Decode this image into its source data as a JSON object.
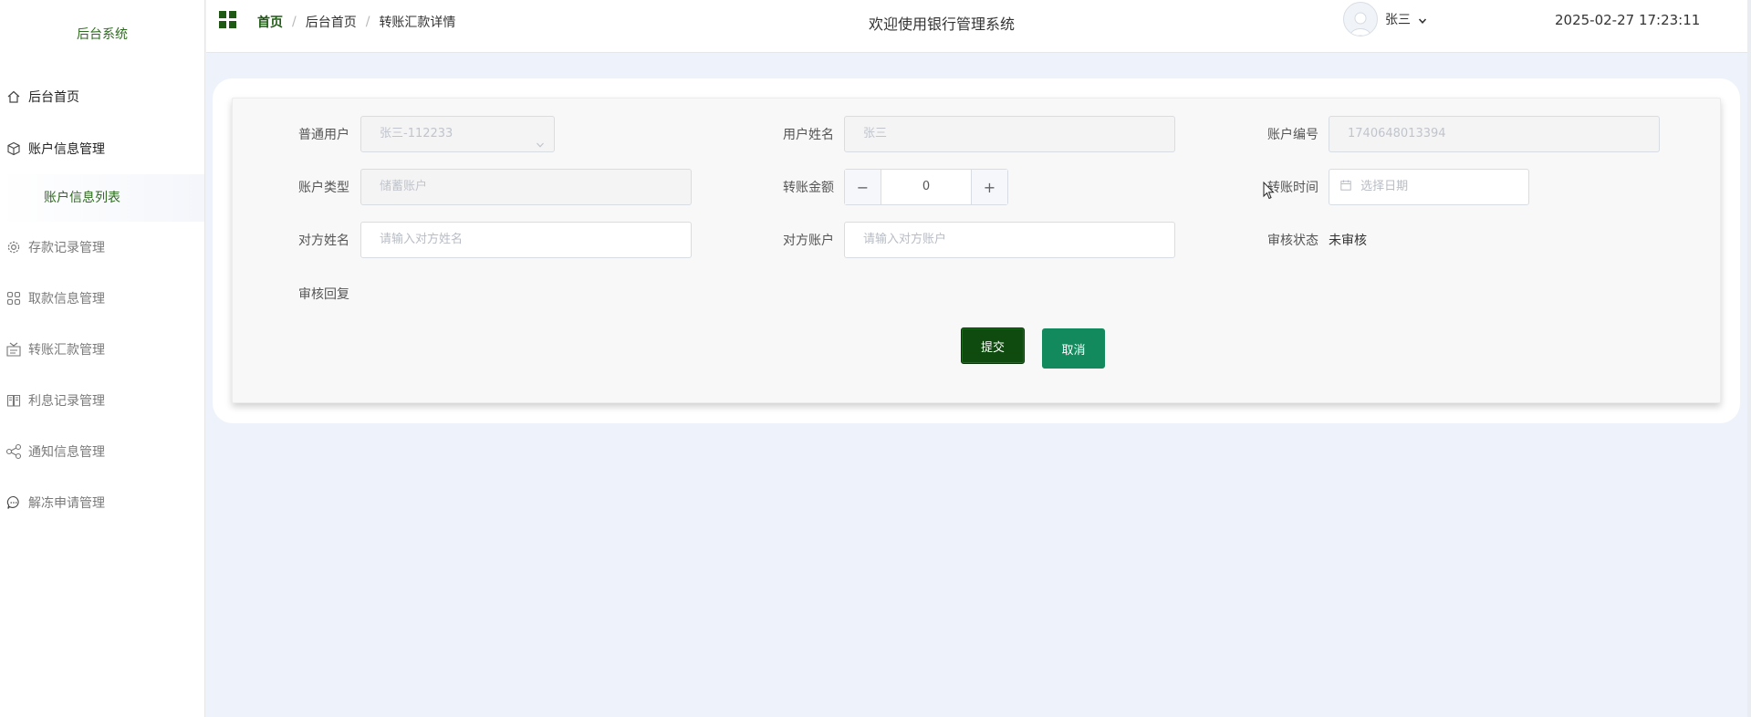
{
  "sidebar": {
    "brand": "后台系统",
    "items": [
      {
        "label": "后台首页",
        "icon": "home-icon"
      },
      {
        "label": "账户信息管理",
        "icon": "cube-icon"
      },
      {
        "label": "账户信息列表",
        "icon": ""
      },
      {
        "label": "存款记录管理",
        "icon": "gear-icon"
      },
      {
        "label": "取款信息管理",
        "icon": "grid-icon"
      },
      {
        "label": "转账汇款管理",
        "icon": "transfer-icon"
      },
      {
        "label": "利息记录管理",
        "icon": "ledger-icon"
      },
      {
        "label": "通知信息管理",
        "icon": "share-icon"
      },
      {
        "label": "解冻申请管理",
        "icon": "chat-icon"
      }
    ]
  },
  "header": {
    "breadcrumb": [
      "首页",
      "后台首页",
      "转账汇款详情"
    ],
    "breadcrumb_separator": "/",
    "title": "欢迎使用银行管理系统",
    "user_name": "张三",
    "datetime": "2025-02-27 17:23:11"
  },
  "form": {
    "user_label": "普通用户",
    "user_value": "张三-112233",
    "name_label": "用户姓名",
    "name_value": "张三",
    "account_no_label": "账户编号",
    "account_no_value": "1740648013394",
    "account_type_label": "账户类型",
    "account_type_value": "储蓄账户",
    "amount_label": "转账金额",
    "amount_value": "0",
    "amount_minus": "−",
    "amount_plus": "+",
    "time_label": "转账时间",
    "time_placeholder": "选择日期",
    "peer_name_label": "对方姓名",
    "peer_name_placeholder": "请输入对方姓名",
    "peer_account_label": "对方账户",
    "peer_account_placeholder": "请输入对方账户",
    "audit_status_label": "审核状态",
    "audit_status_value": "未审核",
    "audit_reply_label": "审核回复",
    "submit_label": "提交",
    "cancel_label": "取消"
  },
  "colors": {
    "brand_green": "#2e6b1f",
    "submit_bg": "#0f4a0f",
    "cancel_bg": "#138a5e",
    "page_bg": "#eef3fb"
  }
}
